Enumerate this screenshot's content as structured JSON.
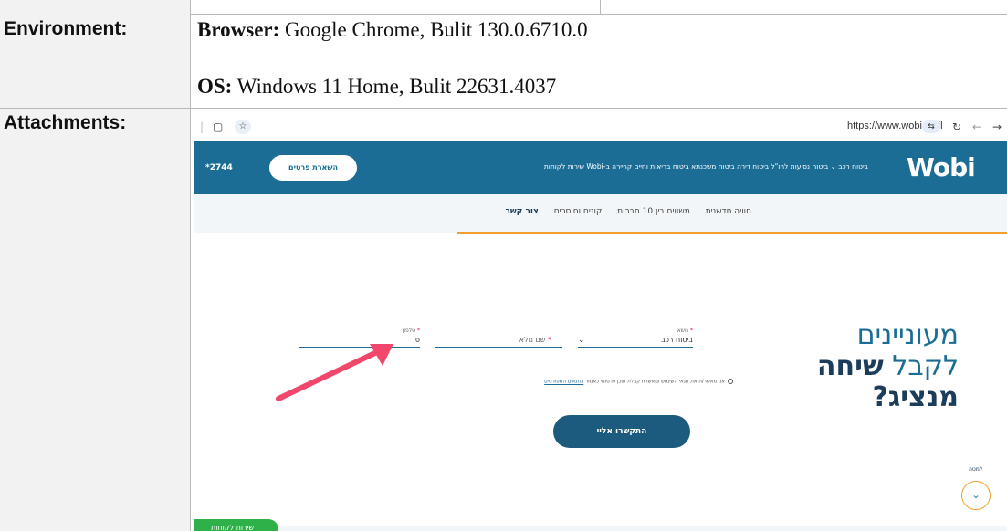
{
  "document": {
    "environment_label": "Environment:",
    "attachments_label": "Attachments:",
    "browser_label": "Browser:",
    "browser_value": " Google Chrome, Bulit 130.0.6710.0",
    "os_label": "OS:",
    "os_value": " Windows 11 Home, Bulit 22631.4037"
  },
  "screenshot": {
    "url": "https://www.wobi.co.il",
    "logo": "Wobi",
    "nav_links": "ביטוח רכב ⌄  ביטוח נסיעות לחו\"ל  ביטוח דירה  ביטוח משכנתא  ביטוח בריאות וחיים  קריירה ב-Wobi  שירות לקוחות",
    "cta_label": "השארת פרטים",
    "phone": "*2744",
    "subnav": [
      "חוויה חדשנית",
      "משווים בין 10 חברות",
      "קונים וחוסכים",
      "צור קשר"
    ],
    "headline_line1": "מעוניינים",
    "headline_line2a": "לקבל ",
    "headline_line2b": "שיחה",
    "headline_line3": "מנציג?",
    "topic_label": "נושא",
    "topic_value": "ביטוח רכב",
    "name_label": "שם מלא",
    "phone_label": "טלפון",
    "phone_value": "ס",
    "consent_text": "אני מאשר/ת את תנאי השימוש ומאשרת קבלת תוכן פרסומי כאמור ",
    "consent_link": "בתנאים המפורטים",
    "submit_label": "התקשרו אליי",
    "down_label": "למטה",
    "chat_label": "שירות לקוחות",
    "accent_color": "#1c6d96",
    "highlight_color": "#f0a030",
    "arrow_color": "#f0476a"
  }
}
